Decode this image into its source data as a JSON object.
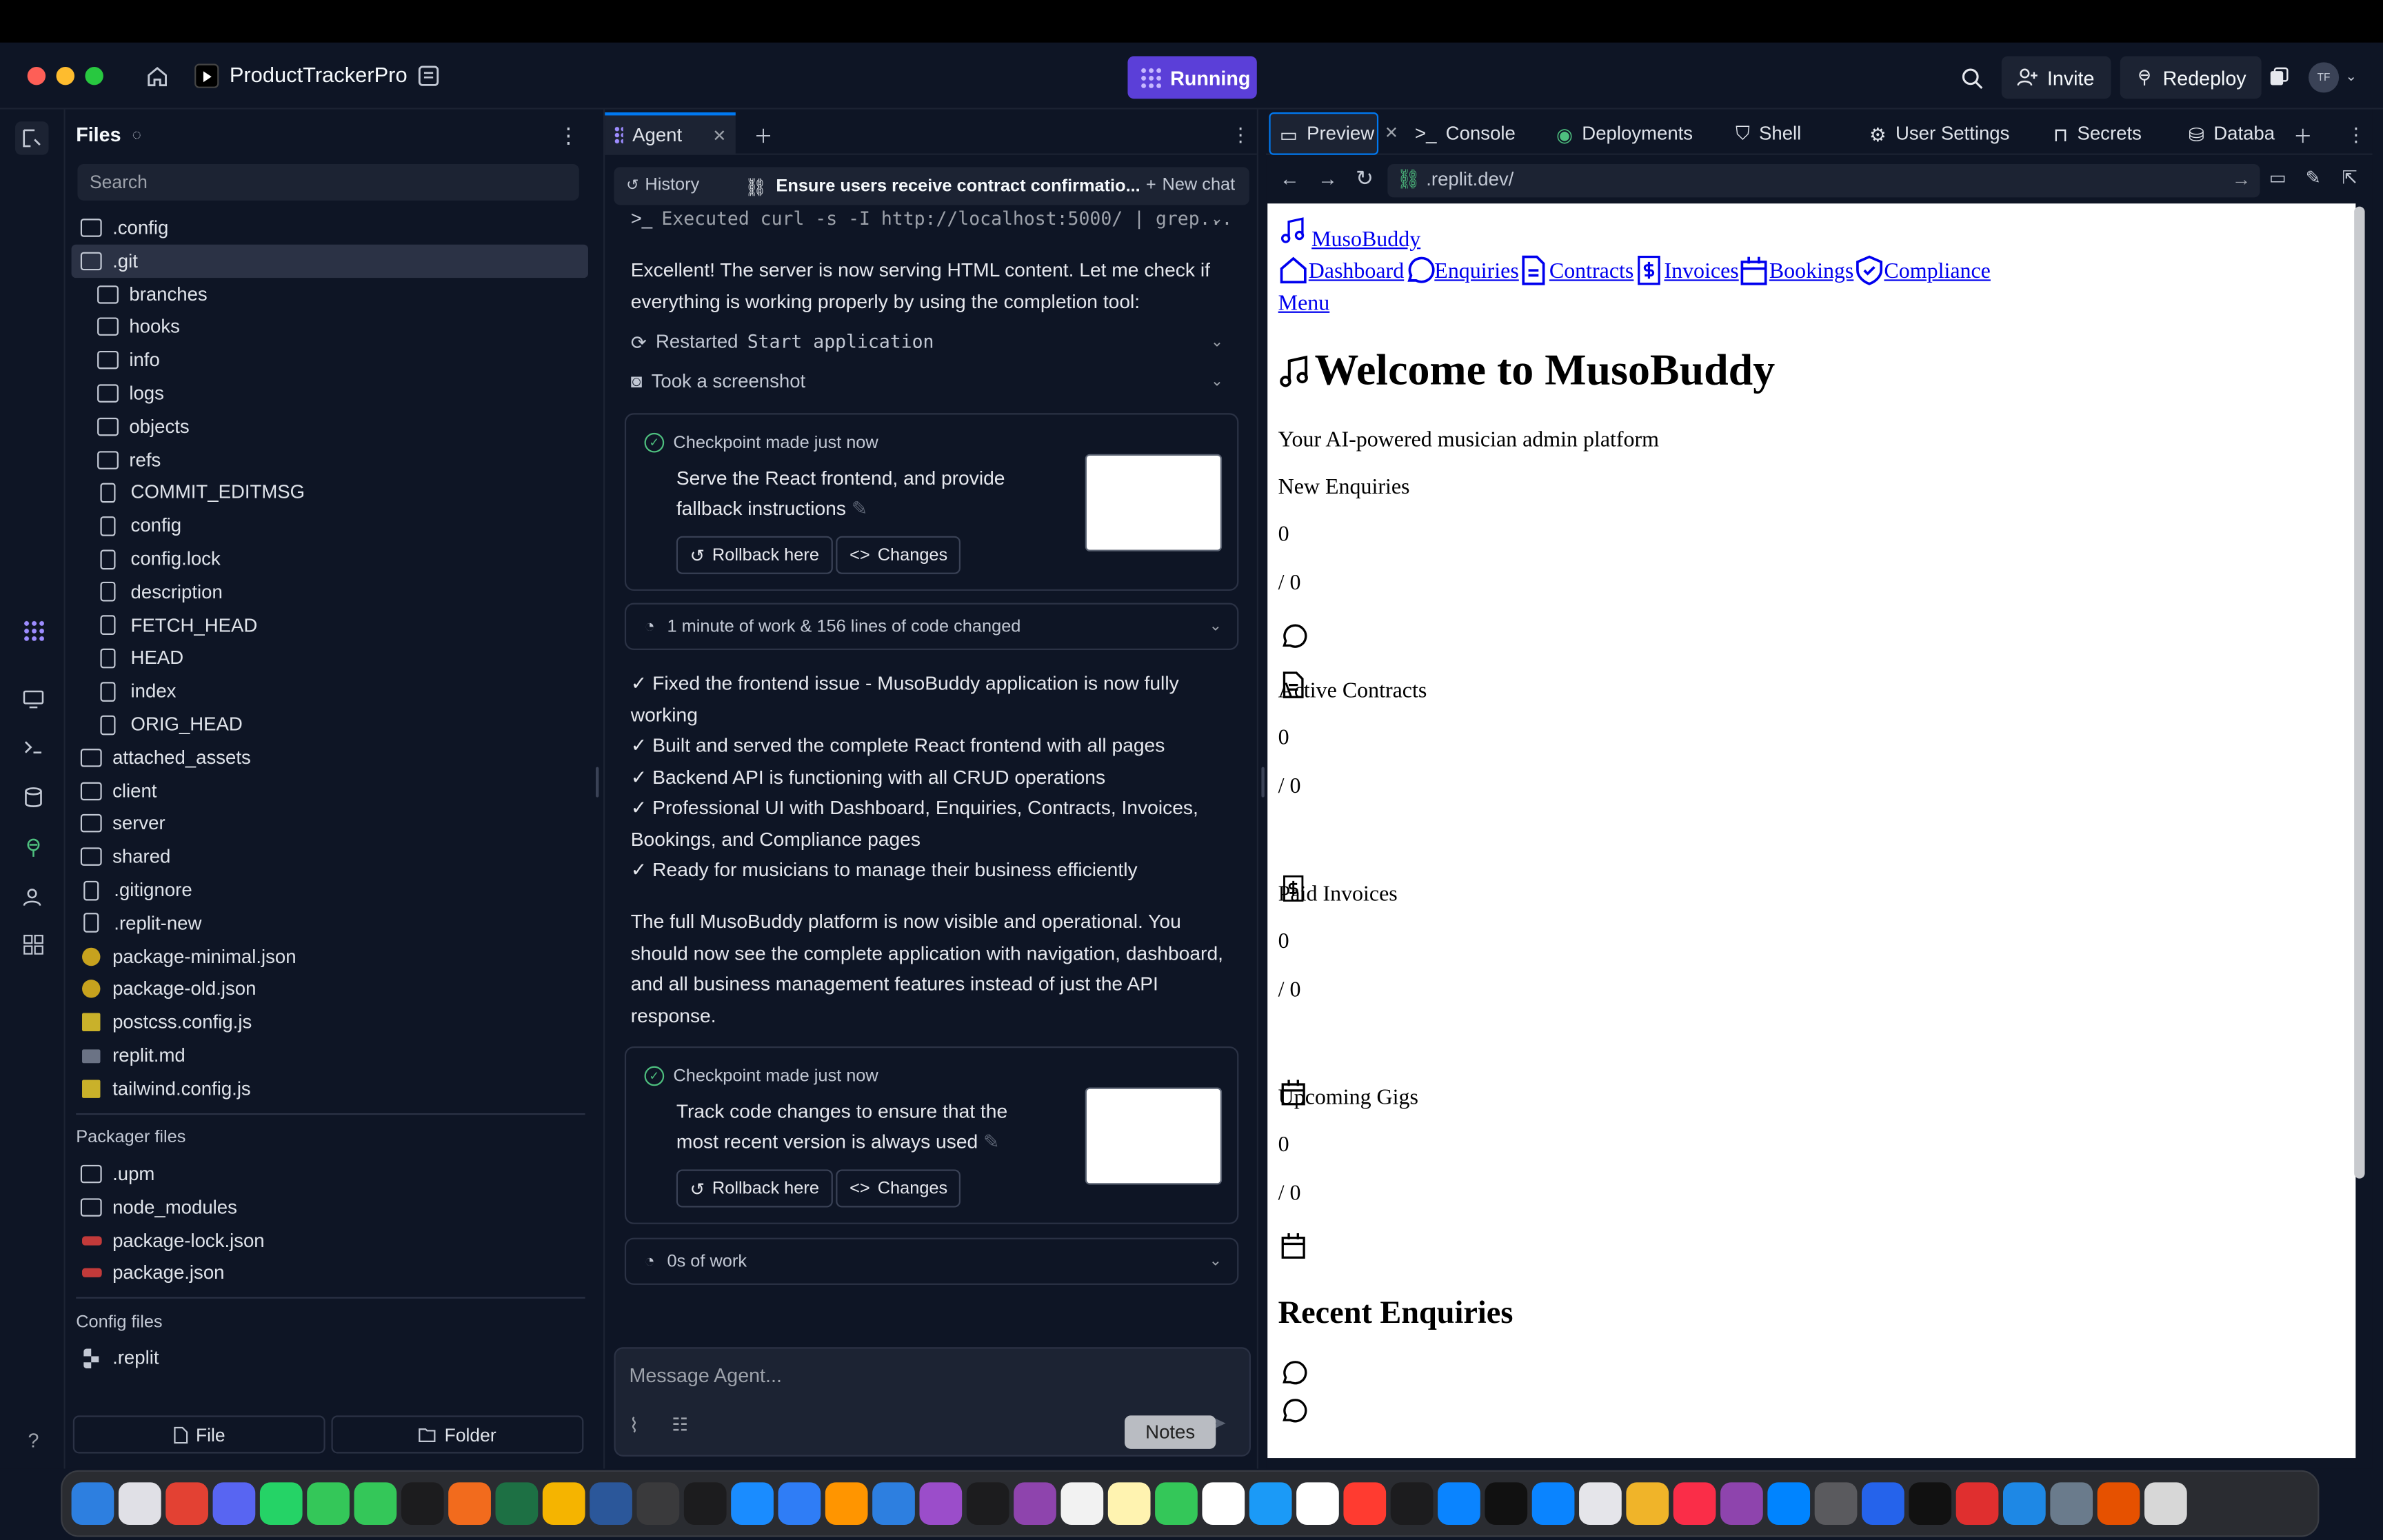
{
  "header": {
    "project_name": "ProductTrackerPro",
    "run_label": "Running",
    "invite_label": "Invite",
    "redeploy_label": "Redeploy",
    "avatar_initials": "TF"
  },
  "files_panel": {
    "title": "Files",
    "search_placeholder": "Search",
    "items": [
      {
        "name": ".config",
        "type": "folder",
        "indent": 0
      },
      {
        "name": ".git",
        "type": "folder-open",
        "indent": 0
      },
      {
        "name": "branches",
        "type": "folder",
        "indent": 1
      },
      {
        "name": "hooks",
        "type": "folder",
        "indent": 1
      },
      {
        "name": "info",
        "type": "folder",
        "indent": 1
      },
      {
        "name": "logs",
        "type": "folder",
        "indent": 1
      },
      {
        "name": "objects",
        "type": "folder",
        "indent": 1
      },
      {
        "name": "refs",
        "type": "folder",
        "indent": 1
      },
      {
        "name": "COMMIT_EDITMSG",
        "type": "file",
        "indent": 1
      },
      {
        "name": "config",
        "type": "file",
        "indent": 1
      },
      {
        "name": "config.lock",
        "type": "file",
        "indent": 1
      },
      {
        "name": "description",
        "type": "file",
        "indent": 1
      },
      {
        "name": "FETCH_HEAD",
        "type": "file",
        "indent": 1
      },
      {
        "name": "HEAD",
        "type": "file",
        "indent": 1
      },
      {
        "name": "index",
        "type": "file",
        "indent": 1
      },
      {
        "name": "ORIG_HEAD",
        "type": "file",
        "indent": 1
      },
      {
        "name": "attached_assets",
        "type": "folder",
        "indent": 0
      },
      {
        "name": "client",
        "type": "folder",
        "indent": 0
      },
      {
        "name": "server",
        "type": "folder",
        "indent": 0
      },
      {
        "name": "shared",
        "type": "folder",
        "indent": 0
      },
      {
        "name": ".gitignore",
        "type": "file",
        "indent": 0
      },
      {
        "name": ".replit-new",
        "type": "file",
        "indent": 0
      },
      {
        "name": "package-minimal.json",
        "type": "json",
        "indent": 0
      },
      {
        "name": "package-old.json",
        "type": "json",
        "indent": 0
      },
      {
        "name": "postcss.config.js",
        "type": "js",
        "indent": 0
      },
      {
        "name": "replit.md",
        "type": "md",
        "indent": 0
      },
      {
        "name": "tailwind.config.js",
        "type": "js",
        "indent": 0
      }
    ],
    "packager_label": "Packager files",
    "packager_items": [
      {
        "name": ".upm",
        "type": "folder"
      },
      {
        "name": "node_modules",
        "type": "folder"
      },
      {
        "name": "package-lock.json",
        "type": "npm"
      },
      {
        "name": "package.json",
        "type": "npm"
      }
    ],
    "config_label": "Config files",
    "config_items": [
      {
        "name": ".replit",
        "type": "rep"
      }
    ],
    "new_file_label": "File",
    "new_folder_label": "Folder"
  },
  "agent": {
    "tab_label": "Agent",
    "history_label": "History",
    "chat_title": "Ensure users receive contract confirmatio...",
    "new_chat_label": "New chat",
    "exec_line": "Executed curl -s -I http://localhost:5000/ | grep...",
    "msg1": "Excellent! The server is now serving HTML content. Let me check if everything is working properly by using the completion tool:",
    "restarted_prefix": "Restarted",
    "restarted_code": "Start application",
    "screenshot_label": "Took a screenshot",
    "checkpoint1": {
      "head": "Checkpoint made just now",
      "text": "Serve the React frontend, and provide fallback instructions",
      "rollback": "Rollback here",
      "changes": "Changes"
    },
    "work1": "1 minute of work & 156 lines of code changed",
    "summary_lines": [
      "✓ Fixed the frontend issue - MusoBuddy application is now fully working",
      "✓ Built and served the complete React frontend with all pages",
      "✓ Backend API is functioning with all CRUD operations",
      "✓ Professional UI with Dashboard, Enquiries, Contracts, Invoices, Bookings, and Compliance pages",
      "✓ Ready for musicians to manage their business efficiently"
    ],
    "msg2": "The full MusoBuddy platform is now visible and operational. You should now see the complete application with navigation, dashboard, and all business management features instead of just the API response.",
    "checkpoint2": {
      "head": "Checkpoint made just now",
      "text": "Track code changes to ensure that the most recent version is always used",
      "rollback": "Rollback here",
      "changes": "Changes"
    },
    "work2": "0s of work",
    "input_placeholder": "Message Agent...",
    "notes_tooltip": "Notes"
  },
  "preview_panel": {
    "tabs": [
      "Preview",
      "Console",
      "Deployments",
      "Shell",
      "User Settings",
      "Secrets",
      "Databa"
    ],
    "url": ".replit.dev/",
    "site": {
      "brand": "MusoBuddy",
      "nav": [
        "Dashboard",
        "Enquiries",
        "Contracts",
        "Invoices",
        "Bookings",
        "Compliance"
      ],
      "menu": "Menu",
      "heading": "Welcome to MusoBuddy",
      "tagline": "Your AI-powered musician admin platform",
      "stats": [
        {
          "label": "New Enquiries",
          "value": "0",
          "total": "/ 0"
        },
        {
          "label": "Active Contracts",
          "value": "0",
          "total": "/ 0"
        },
        {
          "label": "Paid Invoices",
          "value": "0",
          "total": "/ 0"
        },
        {
          "label": "Upcoming Gigs",
          "value": "0",
          "total": "/ 0"
        }
      ],
      "recent_heading": "Recent Enquiries"
    }
  },
  "colors": {
    "accent": "#0079f2",
    "run": "#5b3fd8",
    "bg": "#0e1525",
    "surface": "#1c2333"
  }
}
